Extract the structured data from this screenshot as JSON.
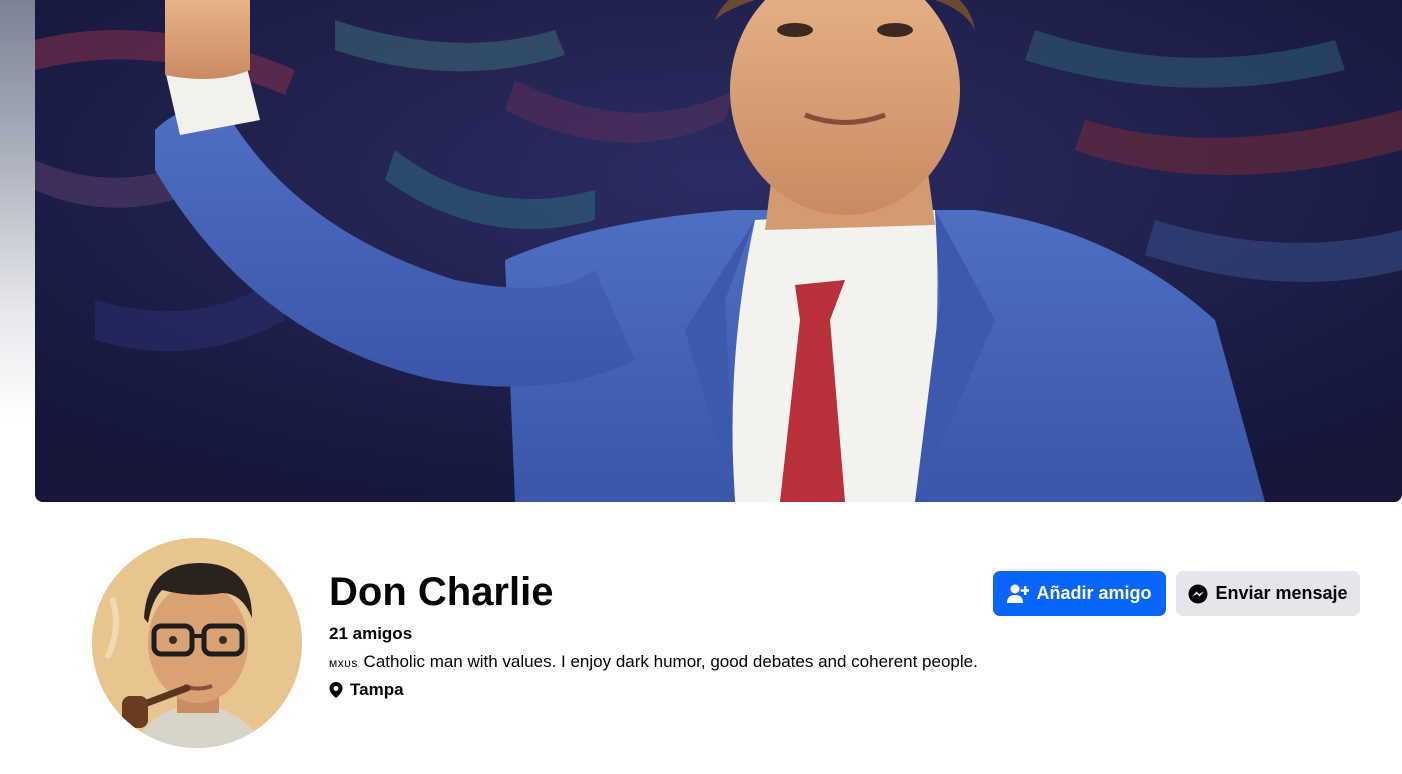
{
  "profile": {
    "name": "Don Charlie",
    "friends": "21 amigos",
    "bio_prefix": "ᴍxᴜs",
    "bio": "Catholic man with values. I enjoy dark humor, good debates and coherent people.",
    "location": "Tampa"
  },
  "actions": {
    "add_friend": "Añadir amigo",
    "send_message": "Enviar mensaje"
  },
  "icons": {
    "add_friend": "person-plus-icon",
    "send_message": "messenger-icon",
    "location": "map-pin-icon"
  },
  "colors": {
    "primary_button": "#0866ff",
    "secondary_button": "#e4e6eb",
    "text": "#050505"
  }
}
